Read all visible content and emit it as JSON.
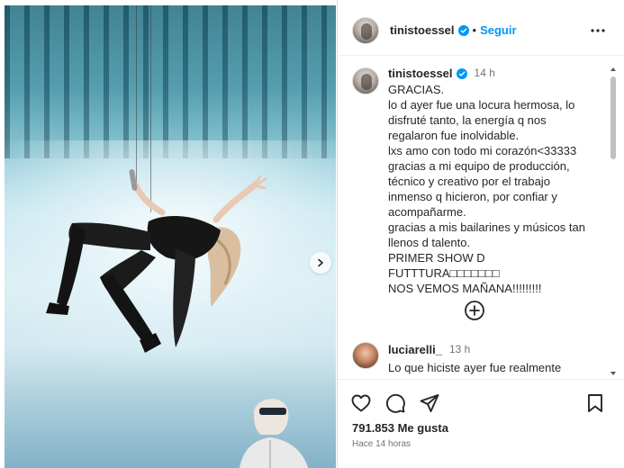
{
  "post": {
    "username": "tinistoessel",
    "follow_label": "Seguir",
    "separator": "•"
  },
  "caption": {
    "username": "tinistoessel",
    "time": "14 h",
    "text": "GRACIAS.\nlo d ayer fue una locura hermosa, lo disfruté tanto, la energía q nos regalaron fue inolvidable.\nlxs amo con todo mi corazón<33333\ngracias a mi equipo de producción, técnico y creativo por el trabajo inmenso q hicieron, por confiar y acompañarme.\ngracias a mis bailarines y músicos tan llenos d talento.\nPRIMER SHOW D FUTTTURA□□□□□□□\nNOS VEMOS MAÑANA!!!!!!!!!"
  },
  "comment": {
    "username": "luciarelli_",
    "time": "13 h",
    "text": "Lo que hiciste ayer fue realmente"
  },
  "stats": {
    "likes": "791.853 Me gusta",
    "posted_ago": "Hace 14 horas"
  },
  "icons": {
    "more": "more-horizontal-icon",
    "verified": "verified-badge-icon",
    "next": "chevron-right-icon",
    "load_more": "plus-circle-icon",
    "like": "heart-icon",
    "comment": "comment-icon",
    "share": "send-icon",
    "save": "bookmark-icon"
  },
  "colors": {
    "accent": "#0095f6",
    "text": "#262626",
    "muted": "#737373"
  }
}
